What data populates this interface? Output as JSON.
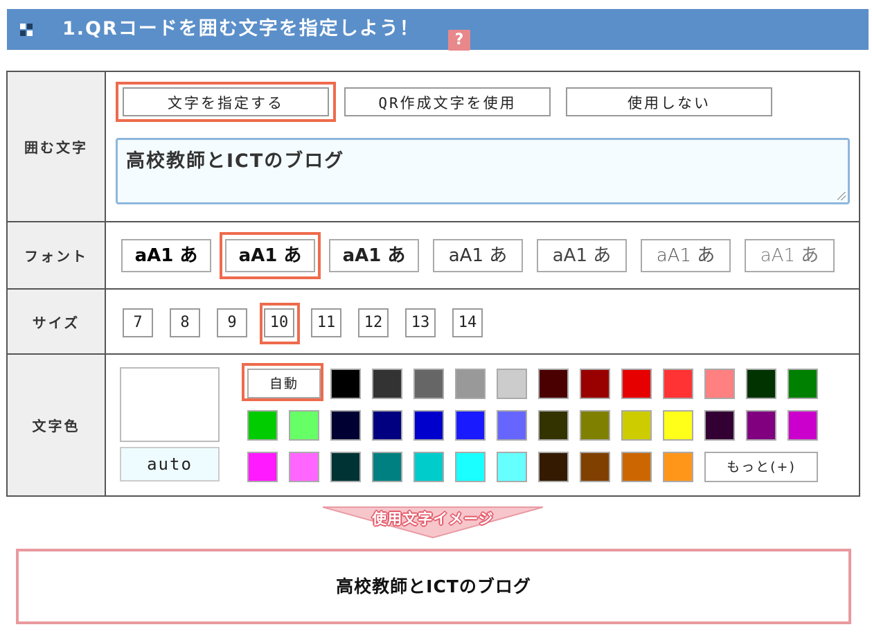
{
  "header": {
    "title": "1.QRコードを囲む文字を指定しよう！",
    "help_label": "?",
    "bg_color": "#5b8fc9"
  },
  "rows": {
    "text": {
      "label": "囲む文字",
      "mode_buttons": [
        "文字を指定する",
        "QR作成文字を使用",
        "使用しない"
      ],
      "selected_mode": 0,
      "input_value": "高校教師とICTのブログ"
    },
    "font": {
      "label": "フォント",
      "sample": "aA1 あ",
      "options": [
        {
          "weight": 900,
          "color": "#000000"
        },
        {
          "weight": 800,
          "color": "#111111"
        },
        {
          "weight": 700,
          "color": "#222222"
        },
        {
          "weight": 500,
          "color": "#333333"
        },
        {
          "weight": 400,
          "color": "#444444"
        },
        {
          "weight": 300,
          "color": "#555555"
        },
        {
          "weight": 200,
          "color": "#777777"
        }
      ],
      "selected": 1
    },
    "size": {
      "label": "サイズ",
      "options": [
        "7",
        "8",
        "9",
        "10",
        "11",
        "12",
        "13",
        "14"
      ],
      "selected": 3
    },
    "color": {
      "label": "文字色",
      "current_value": "auto",
      "auto_label": "自動",
      "more_label": "もっと(+)",
      "swatches_row1": [
        "#000000",
        "#333333",
        "#666666",
        "#999999",
        "#cccccc",
        "#4a0000",
        "#990000",
        "#e60000",
        "#ff3333",
        "#ff8080",
        "#003300",
        "#008000"
      ],
      "swatches_row2": [
        "#00cc00",
        "#66ff66",
        "#000033",
        "#000080",
        "#0000cc",
        "#1a1aff",
        "#6666ff",
        "#333300",
        "#808000",
        "#cccc00",
        "#ffff1a",
        "#330033",
        "#800080",
        "#cc00cc"
      ],
      "swatches_row3": [
        "#ff1aff",
        "#ff66ff",
        "#003333",
        "#008080",
        "#00cccc",
        "#1affff",
        "#66ffff",
        "#331a00",
        "#804000",
        "#cc6600",
        "#ff961a"
      ]
    }
  },
  "banner": {
    "label": "使用文字イメージ"
  },
  "result": {
    "text": "高校教師とICTのブログ"
  },
  "accent_color": "#ee6b4d"
}
